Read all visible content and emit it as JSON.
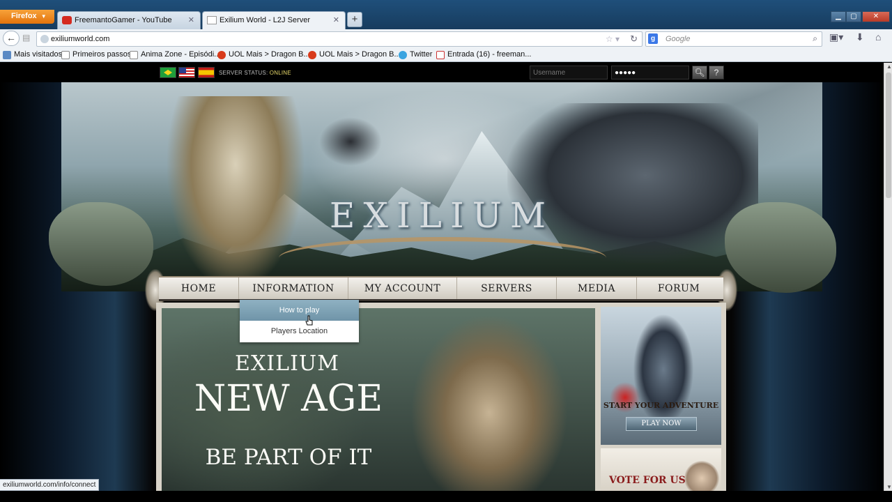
{
  "browser": {
    "menu_button": "Firefox",
    "tabs": [
      {
        "title": "FreemantoGamer - YouTube"
      },
      {
        "title": "Exilium World - L2J Server"
      }
    ],
    "new_tab": "+",
    "url": "exiliumworld.com",
    "search_engine": "Google",
    "search_placeholder": "Google",
    "bookmarks": [
      {
        "label": "Mais visitados"
      },
      {
        "label": "Primeiros passos"
      },
      {
        "label": "Anima Zone - Episódi..."
      },
      {
        "label": "UOL Mais > Dragon B..."
      },
      {
        "label": "UOL Mais > Dragon B..."
      },
      {
        "label": "Twitter"
      },
      {
        "label": "Entrada (16) - freeman..."
      }
    ],
    "status_url": "exiliumworld.com/info/connect"
  },
  "topbar": {
    "status_label": "SERVER STATUS: ",
    "status_value": "ONLINE",
    "username_placeholder": "Username",
    "password_value": "●●●●●",
    "languages": [
      "brazil-flag",
      "usa-flag",
      "spain-flag"
    ]
  },
  "banner": {
    "logo": "EXILIUM"
  },
  "nav": {
    "items": [
      "HOME",
      "INFORMATION",
      "MY ACCOUNT",
      "SERVERS",
      "MEDIA",
      "FORUM"
    ]
  },
  "dropdown": {
    "items": [
      "How to play",
      "Players Location"
    ]
  },
  "hero": {
    "line1": "EXILIUM",
    "line2": "NEW AGE",
    "line3": "BE PART OF IT"
  },
  "promo": {
    "text": "START YOUR ADVENTURE",
    "button": "PLAY NOW"
  },
  "vote": {
    "text": "VOTE FOR US"
  },
  "colors": {
    "accent_online": "#e8d96a",
    "firefox_orange": "#e2730c",
    "vote_red": "#8a1c1c"
  }
}
